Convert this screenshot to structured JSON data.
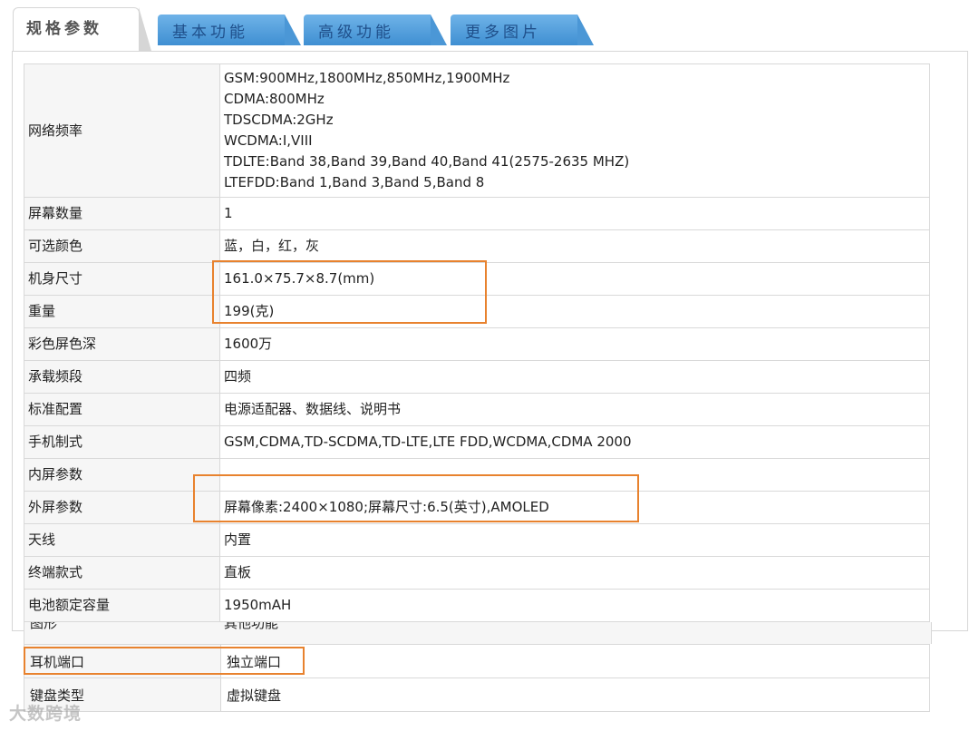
{
  "tabs": [
    {
      "label": "规格参数"
    },
    {
      "label": "基本功能"
    },
    {
      "label": "高级功能"
    },
    {
      "label": "更多图片"
    }
  ],
  "specs": {
    "network": {
      "label": "网络频率",
      "lines": [
        "GSM:900MHz,1800MHz,850MHz,1900MHz",
        "CDMA:800MHz",
        "TDSCDMA:2GHz",
        "WCDMA:I,VIII",
        "TDLTE:Band 38,Band 39,Band 40,Band 41(2575-2635 MHZ)",
        "LTEFDD:Band 1,Band 3,Band 5,Band 8"
      ]
    },
    "rows": [
      {
        "label": "屏幕数量",
        "value": "1"
      },
      {
        "label": "可选颜色",
        "value": "蓝，白，红，灰"
      },
      {
        "label": "机身尺寸",
        "value": "161.0×75.7×8.7(mm)"
      },
      {
        "label": "重量",
        "value": "199(克)"
      },
      {
        "label": "彩色屏色深",
        "value": "1600万"
      },
      {
        "label": "承载频段",
        "value": "四频"
      },
      {
        "label": "标准配置",
        "value": "电源适配器、数据线、说明书"
      },
      {
        "label": "手机制式",
        "value": "GSM,CDMA,TD-SCDMA,TD-LTE,LTE FDD,WCDMA,CDMA 2000"
      },
      {
        "label": "内屏参数",
        "value": ""
      },
      {
        "label": "外屏参数",
        "value": "屏幕像素:2400×1080;屏幕尺寸:6.5(英寸),AMOLED"
      },
      {
        "label": "天线",
        "value": "内置"
      },
      {
        "label": "终端款式",
        "value": "直板"
      },
      {
        "label": "电池额定容量",
        "value": "1950mAH"
      }
    ]
  },
  "lower": {
    "cut_label": "图形",
    "cut_value": "其他功能",
    "rows": [
      {
        "label": "耳机端口",
        "value": "独立端口"
      },
      {
        "label": "键盘类型",
        "value": "虚拟键盘"
      }
    ]
  },
  "watermark": "大数跨境",
  "colors": {
    "highlight": "#e8822e",
    "tab_blue": "#4b97d6",
    "label_bg": "#f6f6f6",
    "border": "#d9d9d9"
  }
}
